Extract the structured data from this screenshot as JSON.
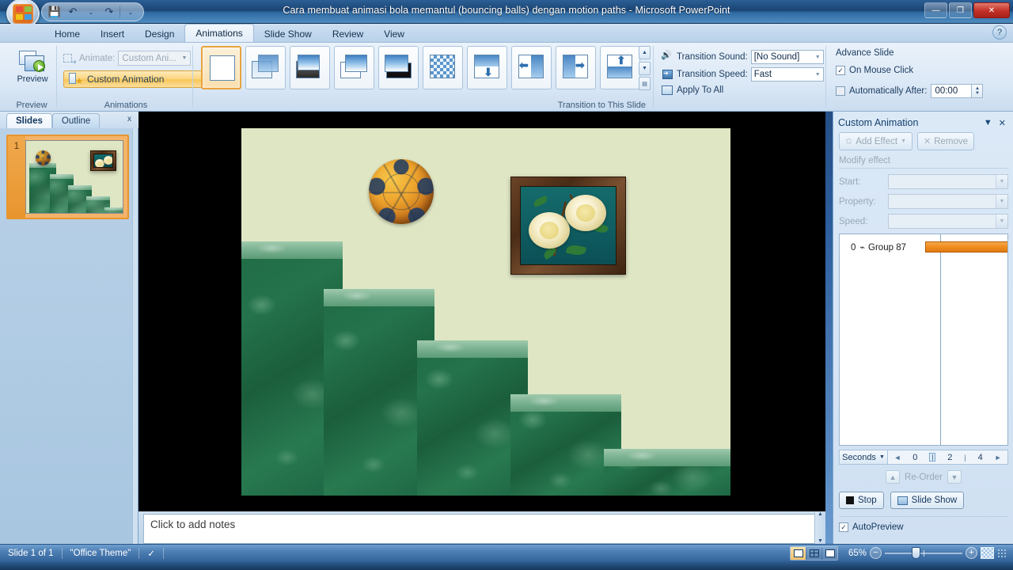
{
  "window": {
    "title": "Cara membuat animasi bola memantul (bouncing balls) dengan motion paths  -  Microsoft PowerPoint",
    "minimize_label": "—",
    "restore_label": "❐",
    "close_label": "✕"
  },
  "quick_access": {
    "save_label": "💾",
    "undo_label": "↶",
    "undo_dropdown_label": "⌄",
    "redo_label": "↷",
    "customize_label": "⌄"
  },
  "office_button": {
    "label": "Office"
  },
  "ribbon": {
    "tabs": [
      {
        "label": "Home",
        "active": false
      },
      {
        "label": "Insert",
        "active": false
      },
      {
        "label": "Design",
        "active": false
      },
      {
        "label": "Animations",
        "active": true
      },
      {
        "label": "Slide Show",
        "active": false
      },
      {
        "label": "Review",
        "active": false
      },
      {
        "label": "View",
        "active": false
      }
    ],
    "help_label": "?",
    "groups": {
      "preview": {
        "title": "Preview",
        "button_label": "Preview"
      },
      "animations": {
        "title": "Animations",
        "animate_label": "Animate:",
        "animate_value": "Custom Ani...",
        "custom_animation_label": "Custom Animation"
      },
      "transition": {
        "title": "Transition to This Slide",
        "items": [
          {
            "name": "no-transition",
            "selected": true
          },
          {
            "name": "blinds-fade-smoothly"
          },
          {
            "name": "cut-through-black"
          },
          {
            "name": "fade-smoothly"
          },
          {
            "name": "fade-through-black"
          },
          {
            "name": "dissolve"
          },
          {
            "name": "wipe-down"
          },
          {
            "name": "wipe-left"
          },
          {
            "name": "wipe-right"
          },
          {
            "name": "wipe-up"
          }
        ],
        "scroll_up": "▲",
        "scroll_down": "▼",
        "more": "▤"
      },
      "options": {
        "sound_label": "Transition Sound:",
        "sound_value": "[No Sound]",
        "speed_label": "Transition Speed:",
        "speed_value": "Fast",
        "apply_all_label": "Apply To All"
      },
      "advance": {
        "title": "Advance Slide",
        "on_mouse_click_label": "On Mouse Click",
        "on_mouse_click_checked": "✓",
        "automatically_after_label": "Automatically After:",
        "automatically_after_value": "00:00",
        "spin_up": "▲",
        "spin_down": "▼"
      }
    }
  },
  "slides_pane": {
    "tabs": [
      {
        "label": "Slides",
        "active": true
      },
      {
        "label": "Outline",
        "active": false
      }
    ],
    "close_label": "x",
    "thumbnail": {
      "number": "1"
    }
  },
  "notes": {
    "placeholder": "Click to add notes",
    "scroll_up": "▲",
    "scroll_down": "▼"
  },
  "task_pane": {
    "title": "Custom Animation",
    "dropdown_label": "▼",
    "close_label": "✕",
    "add_effect_label": "Add Effect",
    "add_effect_arrow": "▼",
    "add_effect_icon": "✩",
    "remove_label": "Remove",
    "remove_icon": "✕",
    "modify_effect_label": "Modify effect",
    "fields": [
      {
        "label": "Start:",
        "value": ""
      },
      {
        "label": "Property:",
        "value": ""
      },
      {
        "label": "Speed:",
        "value": ""
      }
    ],
    "dropdown_arrow": "▼",
    "animation_list": [
      {
        "index": "0",
        "icon": "⌁",
        "label": "Group 87"
      }
    ],
    "timeline": {
      "unit_label": "Seconds",
      "unit_arrow": "▼",
      "prev_arrow": "◄",
      "next_arrow": "►",
      "ticks": [
        "0",
        "|",
        "2",
        "|",
        "4"
      ]
    },
    "reorder_label": "Re-Order",
    "reorder_up": "▲",
    "reorder_down": "▼",
    "stop_label": "Stop",
    "slide_show_label": "Slide Show",
    "autopreview_label": "AutoPreview",
    "autopreview_checked": "✓"
  },
  "status_bar": {
    "slide_counter": "Slide 1 of 1",
    "theme": "\"Office Theme\"",
    "spell_icon": "✓",
    "zoom_level": "65%",
    "zoom_out_label": "−",
    "zoom_in_label": "+",
    "views": [
      {
        "name": "normal",
        "active": true
      },
      {
        "name": "slide-sorter",
        "active": false
      },
      {
        "name": "slide-show",
        "active": false
      }
    ],
    "fit_label": "fit-to-window"
  },
  "colors": {
    "accent_orange": "#f08c1e",
    "slide_bg": "#dfe6c4",
    "stair_green": "#1f6b45",
    "ball_orange": "#eda32c",
    "ball_navy": "#1d3a63",
    "frame_brown": "#4a2c16",
    "picture_teal": "#0f5f62",
    "titlebar_blue": "#1b4472",
    "selected_gold": "#e8a33d"
  }
}
